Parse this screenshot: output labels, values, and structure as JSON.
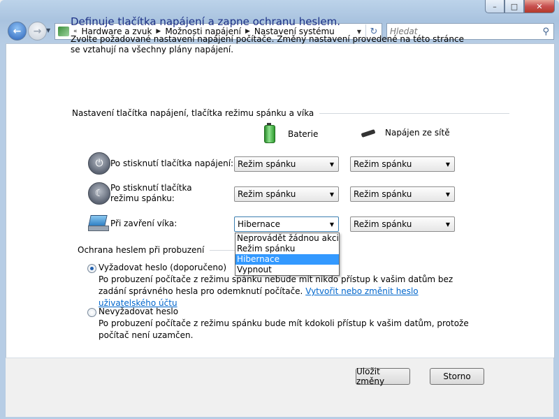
{
  "navigation": {
    "breadcrumbs": [
      "Hardware a zvuk",
      "Možnosti napájení",
      "Nastavení systému"
    ],
    "search_placeholder": "Hledat"
  },
  "page": {
    "title": "Definuje tlačítka napájení a zapne ochranu heslem.",
    "intro": "Zvolte požadované nastavení napájení počítače. Změny nastavení provedené na této stránce se vztahují na všechny plány napájení.",
    "buttons_section": "Nastavení tlačítka napájení, tlačítka režimu spánku a víka",
    "columns": {
      "battery": "Baterie",
      "ac": "Napájen ze sítě"
    },
    "rows": [
      {
        "label": "Po stisknutí tlačítka napájení:",
        "battery": "Režim spánku",
        "ac": "Režim spánku"
      },
      {
        "label": "Po stisknutí tlačítka režimu spánku:",
        "battery": "Režim spánku",
        "ac": "Režim spánku"
      },
      {
        "label": "Při zavření víka:",
        "battery": "Hibernace",
        "ac": "Režim spánku"
      }
    ],
    "dropdown_options": [
      "Neprovádět žádnou akci",
      "Režim spánku",
      "Hibernace",
      "Vypnout"
    ],
    "dropdown_selected": "Hibernace",
    "password_section": "Ochrana heslem při probuzení",
    "require_password": {
      "label": "Vyžadovat heslo (doporučeno)",
      "description": "Po probuzení počítače z režimu spánku nebude mít nikdo přístup k vašim datům bez zadání správného hesla pro odemknutí počítače.",
      "link": "Vytvořit nebo změnit heslo uživatelského účtu",
      "selected": true
    },
    "no_password": {
      "label": "Nevyžadovat heslo",
      "description": "Po probuzení počítače z režimu spánku bude mít kdokoli přístup k vašim datům, protože počítač není uzamčen.",
      "selected": false
    }
  },
  "footer": {
    "save": "Uložit změny",
    "cancel": "Storno"
  }
}
